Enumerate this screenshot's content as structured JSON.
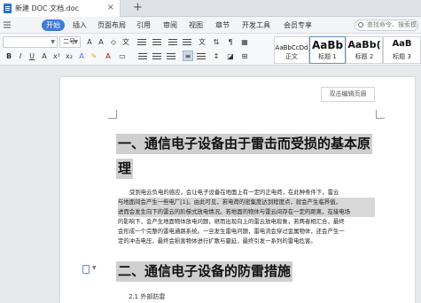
{
  "tab": {
    "title": "新建 DOC 文档.doc",
    "close": "×",
    "new": "+"
  },
  "menu": {
    "items": [
      "开始",
      "插入",
      "页面布局",
      "引用",
      "审阅",
      "视图",
      "章节",
      "开发工具",
      "会员专享"
    ],
    "active_index": 0,
    "search_placeholder": "查找命令、搜索模板"
  },
  "ribbon": {
    "font_name": "",
    "font_size": "二号",
    "styles": [
      {
        "sample": "AaBbCcDd",
        "name": "正文"
      },
      {
        "sample": "AaBb",
        "name": "标题 1"
      },
      {
        "sample": "AaBb(",
        "name": "标题 2"
      },
      {
        "sample": "AaB",
        "name": "标题 3"
      }
    ]
  },
  "document": {
    "double_page_button": "双击编辑页眉",
    "heading1_line1": "一、通信电子设备由于雷击而受损的基本原",
    "heading1_line2": "理",
    "paragraph_lines": [
      "受到电云负电的感应，会让电子设备在地面上有一定的正电荷，在此种条件下，雷云",
      "与地面间会产生一些电厂[1]。由此可见，若电荷的密集度达到程度点，就会产生临界值，",
      "进而会发生向下的雷云的阶梯式放电情况。若地面的物体与雷云间存在一定的距离，在接电场",
      "的影响下，会产生地面物体放电问题，继而出现向上的雷云放电现象，若两者相汇合，最终",
      "会形成一个完整的雷电通路系统。一旦发生雷电问题，雷电流会穿过金属物体，还会产生一",
      "定的冲击电压，最终会损害物体进行扩散与蔓延，最终引发一系列的雷电危害。"
    ],
    "heading2": "二、通信电子设备的防雷措施",
    "subheading": "2.1 外部防雷"
  }
}
